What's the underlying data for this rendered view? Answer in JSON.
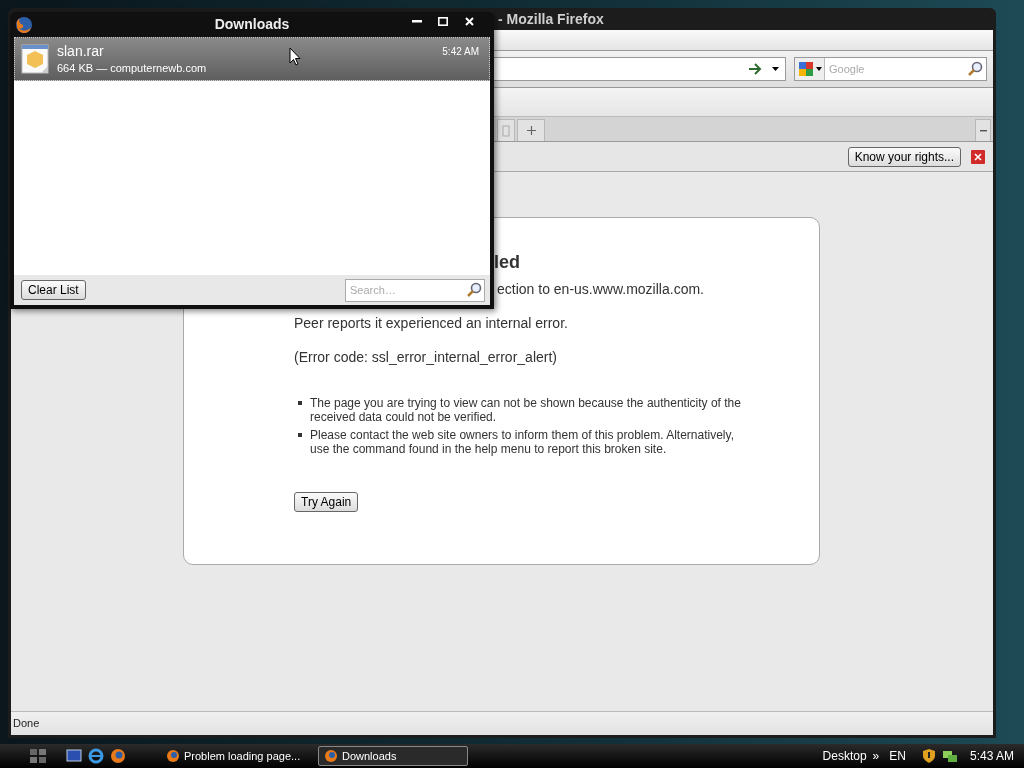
{
  "firefox": {
    "title": "- Mozilla Firefox",
    "search": {
      "placeholder": "Google"
    },
    "notification": {
      "button": "Know your rights..."
    },
    "error_page": {
      "title": "led",
      "lines": [
        "ection to en-us.www.mozilla.com.",
        "Peer reports it experienced an internal error.",
        "(Error code: ssl_error_internal_error_alert)"
      ],
      "bullets": [
        "The page you are trying to view can not be shown because the authenticity of the received data could not be verified.",
        "Please contact the web site owners to inform them of this problem. Alternatively, use the command found in the help menu to report this broken site."
      ],
      "button": "Try Again"
    },
    "status": "Done"
  },
  "downloads": {
    "title": "Downloads",
    "items": [
      {
        "name": "slan.rar",
        "info": "664 KB — computernewb.com",
        "time": "5:42 AM",
        "selected": true
      }
    ],
    "clear_button": "Clear List",
    "search": {
      "placeholder": "Search…"
    }
  },
  "taskbar": {
    "tasks": [
      {
        "label": "Problem loading page...",
        "selected": false
      },
      {
        "label": "Downloads",
        "selected": true
      }
    ],
    "tray": [
      "Desktop",
      "»",
      "EN"
    ],
    "clock": "5:43 AM"
  }
}
